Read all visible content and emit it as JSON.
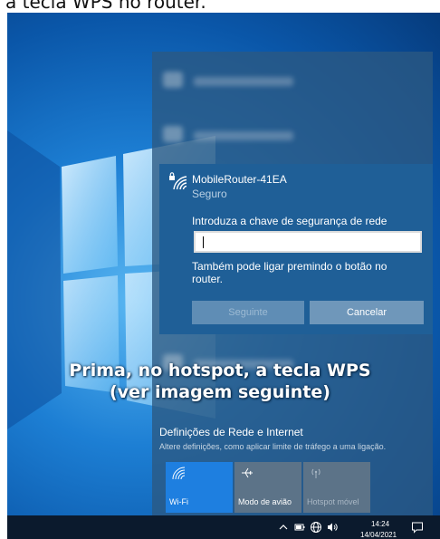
{
  "caption": {
    "text": "a tecla WPS no router."
  },
  "network_panel": {
    "network_name": "MobileRouter-41EA",
    "network_status": "Seguro",
    "key_label": "Introduza a chave de segurança de rede",
    "key_value": "",
    "wps_hint": "Também pode ligar premindo o botão no router.",
    "next_button": "Seguinte",
    "cancel_button": "Cancelar"
  },
  "overlay": {
    "line1": "Prima, no hotspot, a tecla WPS",
    "line2": "(ver imagem seguinte)"
  },
  "settings": {
    "title": "Definições de Rede e Internet",
    "subtitle": "Altere definições, como aplicar limite de tráfego a uma ligação."
  },
  "quick_actions": [
    {
      "label": "Wi-Fi",
      "icon": "wifi-icon",
      "state": "on"
    },
    {
      "label": "Modo de avião",
      "icon": "airplane-icon",
      "state": "off"
    },
    {
      "label": "Hotspot móvel",
      "icon": "hotspot-icon",
      "state": "disabled"
    }
  ],
  "taskbar": {
    "time": "14:24",
    "date": "14/04/2021",
    "icons": [
      "chevron-up-icon",
      "battery-icon",
      "network-globe-icon",
      "volume-icon",
      "notification-icon"
    ]
  },
  "colors": {
    "accent": "#1e7fe0",
    "panel": "#1f5f97",
    "taskbar": "#0b1a2d"
  }
}
